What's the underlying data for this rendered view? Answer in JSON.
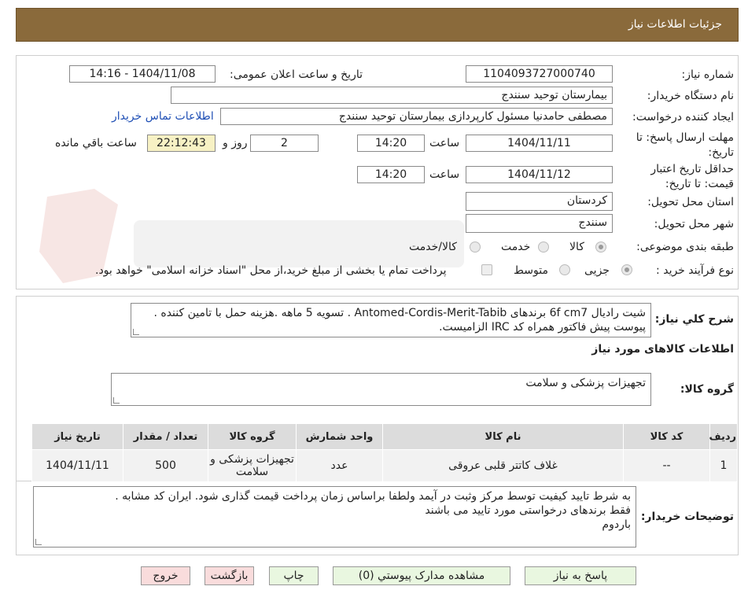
{
  "header": {
    "title": "جزئیات اطلاعات نیاز"
  },
  "fields": {
    "need_number_label": "شماره نیاز:",
    "need_number": "1104093727000740",
    "announce_label": "تاریخ و ساعت اعلان عمومی:",
    "announce_value": "1404/11/08 - 14:16",
    "buyer_label": "نام دستگاه خریدار:",
    "buyer_value": "بیمارستان توحید سنندج",
    "creator_label": "ایجاد کننده درخواست:",
    "creator_value": "مصطفی حامدنیا مسئول کارپردازی بیمارستان توحید سنندج",
    "contact_link": "اطلاعات تماس خریدار",
    "reply_deadline_label": "مهلت ارسال پاسخ: تا تاریخ:",
    "reply_date": "1404/11/11",
    "time_label": "ساعت",
    "reply_time": "14:20",
    "days_value": "2",
    "days_label": "روز و",
    "remaining_time": "22:12:43",
    "remaining_label": "ساعت باقي مانده",
    "validity_label": "حداقل تاریخ اعتبار قیمت: تا تاریخ:",
    "validity_date": "1404/11/12",
    "validity_time": "14:20",
    "province_label": "استان محل تحویل:",
    "province_value": "کردستان",
    "city_label": "شهر محل تحویل:",
    "city_value": "سنندج",
    "category_label": "طبقه بندی موضوعی:",
    "category_options": [
      "کالا",
      "خدمت",
      "کالا/خدمت"
    ],
    "process_label": "نوع فرآیند خرید :",
    "process_options": [
      "جزیی",
      "متوسط"
    ],
    "process_note": "پرداخت تمام یا بخشی از مبلغ خرید،از محل \"اسناد خزانه اسلامی\" خواهد بود."
  },
  "summary": {
    "label": "شرح کلي نياز:",
    "line1": "شیت رادیال 6f cm7 برندهای Antomed-Cordis-Merit-Tabib . تسویه 5 ماهه .هزینه حمل با تامین کننده .",
    "line2": "پیوست پیش فاکتور همراه کد IRC  الزامیست."
  },
  "goods": {
    "section_title": "اطلاعات کالاهای مورد نیاز",
    "group_label": "گروه کالا:",
    "group_value": "تجهیزات پزشکی و سلامت"
  },
  "table": {
    "headers": [
      "ردیف",
      "کد کالا",
      "نام کالا",
      "واحد شمارش",
      "گروه کالا",
      "تعداد / مقدار",
      "تاریخ نیاز"
    ],
    "rows": [
      [
        "1",
        "--",
        "غلاف کاتتر قلبی عروقی",
        "عدد",
        "تجهیزات پزشکی و سلامت",
        "500",
        "1404/11/11"
      ]
    ]
  },
  "buyer_notes": {
    "label": "توضیحات خریدار:",
    "line1": "به شرط تایید کیفیت توسط مرکز وثبت در آیمد ولطفا براساس زمان پرداخت  قیمت گذاری شود. ایران کد مشابه .",
    "line2": "فقط برندهای درخواستی مورد تایید می باشند",
    "line3": "باردوم"
  },
  "buttons": {
    "reply": "پاسخ به نیاز",
    "attachments": "مشاهده مدارک پیوستي (0)",
    "print": "چاپ",
    "back": "بازگشت",
    "exit": "خروج"
  },
  "colors": {
    "header_bg": "#8a6a3b",
    "button_green": "#e9f7e0",
    "button_pink": "#f9dcdc",
    "remaining_bg": "#f7f1c4"
  }
}
